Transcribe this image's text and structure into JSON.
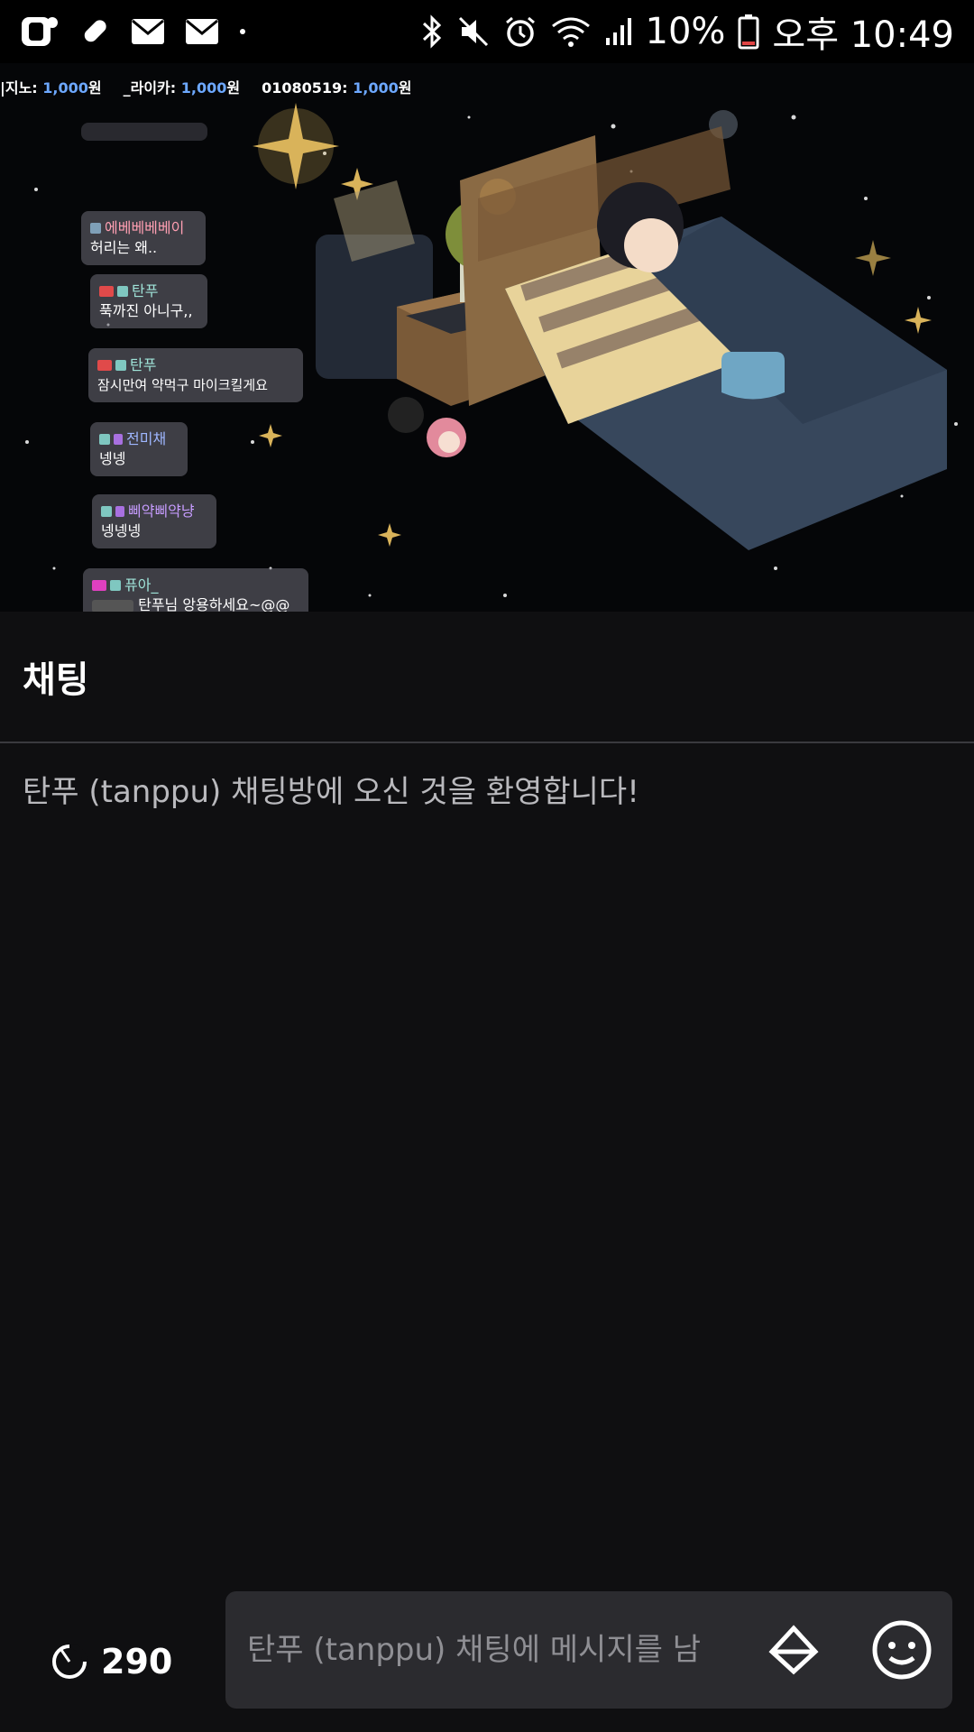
{
  "status_bar": {
    "battery": "10%",
    "time": "오후 10:49",
    "icons": [
      "app-icon",
      "pill-icon",
      "mail-icon",
      "mail-icon",
      "bluetooth-icon",
      "mute-icon",
      "alarm-icon",
      "wifi-icon",
      "signal-icon",
      "battery-icon"
    ]
  },
  "video": {
    "donations": [
      {
        "name": "|지노: ",
        "amount": "1,000",
        "unit": "원"
      },
      {
        "name": "_라이카: ",
        "amount": "1,000",
        "unit": "원"
      },
      {
        "name": "01080519: ",
        "amount": "1,000",
        "unit": "원"
      }
    ],
    "overlay_messages": [
      {
        "name": "에베베베베이",
        "text": "허리는 왜.."
      },
      {
        "name": "탄푸",
        "text": "푹까진 아니구,,"
      },
      {
        "name": "탄푸",
        "text": "잠시만여 약먹구 마이크킬게요"
      },
      {
        "name": "전미채",
        "text": "넹넹"
      },
      {
        "name": "삐약삐약냥",
        "text": "넹넹넹"
      },
      {
        "name": "퓨아_",
        "text": "탄푸님 앙용하세요~@@"
      }
    ]
  },
  "chat": {
    "title": "채팅",
    "welcome": "탄푸 (tanppu) 채팅방에 오신 것을 환영합니다!"
  },
  "bottom": {
    "viewer_count": "290",
    "input_placeholder": "탄푸 (tanppu) 채팅에 메시지를 남"
  },
  "colors": {
    "background": "#0f0f11",
    "input_bg": "#2b2b2f",
    "donation_amount": "#6da8ff"
  }
}
